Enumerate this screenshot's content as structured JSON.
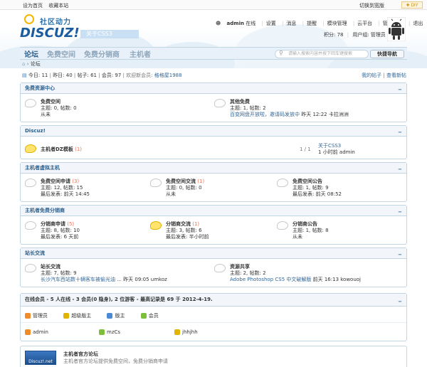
{
  "topbar": {
    "set_home": "设为首页",
    "bookmark": "收藏本站",
    "switch_width": "切换到宽版",
    "diy": "DIY"
  },
  "header": {
    "logo_cn": "社区动力",
    "logo_en": "DISCUZ!",
    "about": "关于CSS3",
    "user": {
      "name": "admin",
      "status": "在线",
      "links": [
        "设置",
        "消息",
        "提醒",
        "模块管理",
        "云平台",
        "管理中心",
        "退出"
      ],
      "points_label": "积分: 78",
      "group_label": "用户组: 管理员"
    }
  },
  "nav": {
    "items": [
      "论坛",
      "免费空间",
      "免费分销商",
      "主机者"
    ],
    "search_placeholder": "请输入搜索内容并按下回车键搜索",
    "quick_nav": "快捷导航"
  },
  "breadcrumb": {
    "label": "论坛"
  },
  "stats": {
    "today": "今日: 11",
    "yesterday": "昨日: 40",
    "posts": "帖子: 61",
    "members": "会员: 97",
    "welcome_prefix": "欢迎新会员: ",
    "new_member": "格格屋1988",
    "my_posts": "我的帖子",
    "new_posts": "查看新帖"
  },
  "categories": [
    {
      "title": "免费资源中心",
      "forums": [
        {
          "name": "免费空间",
          "count": "",
          "line2": "主题: 0, 帖数: 0",
          "line3": "从未",
          "line3_link": "",
          "line3_time": ""
        },
        {
          "name": "其他免费",
          "count": "",
          "line2": "主题: 1, 帖数: 2",
          "line3": "",
          "line3_link": "百变网盘开放啦，邀请码发放中",
          "line3_time": "昨天 12:22  卡拉洲洲"
        }
      ]
    },
    {
      "title": "Discuz!",
      "forums": [
        {
          "name": "主机者DZ模板",
          "count": "(1)",
          "pages": "1 / 1",
          "last_link": "关于CSS3",
          "last_time": "1 小时前  admin"
        }
      ]
    },
    {
      "title": "主机者虚拟主机",
      "forums": [
        {
          "name": "免费空间申请",
          "count": "(3)",
          "line2": "主题: 12, 帖数: 15",
          "line3": "最后发表: 前天 14:45"
        },
        {
          "name": "免费空间交流",
          "count": "(1)",
          "line2": "主题: 0, 帖数: 0",
          "line3": "从未"
        },
        {
          "name": "免费空间公告",
          "count": "",
          "line2": "主题: 1, 帖数: 9",
          "line3": "最后发表: 前天 08:52"
        }
      ]
    },
    {
      "title": "主机者免费分销商",
      "forums": [
        {
          "name": "分销商申请",
          "count": "(5)",
          "line2": "主题: 8, 帖数: 10",
          "line3": "最后发表: 6 天前"
        },
        {
          "name": "分销商交流",
          "count": "(1)",
          "line2": "主题: 3, 帖数: 6",
          "line3": "最后发表: 半小时前"
        },
        {
          "name": "分销商公告",
          "count": "",
          "line2": "主题: 1, 帖数: 8",
          "line3": "从未"
        }
      ]
    },
    {
      "title": "站长交流",
      "forums": [
        {
          "name": "站长交流",
          "count": "",
          "line2": "主题: 7, 帖数: 9",
          "line3_link": "长沙汽车西站数十辆客车被偷光油 ...",
          "line3_time": "昨天 09:05  umkoz"
        },
        {
          "name": "资源共享",
          "count": "",
          "line2": "主题: 2, 帖数: 2",
          "line3_link": "Adobe Photoshop CS5 中文破解版",
          "line3_time": "前天 16:13  kowouoj"
        }
      ]
    }
  ],
  "online": {
    "title": "在线会员 - 5 人在线 - 3 会员(0 隐身), 2 位游客 - 最高记录是 69 于 2012-4-19.",
    "legend": [
      "管理员",
      "超级版主",
      "版主",
      "会员"
    ],
    "users": [
      "admin",
      "mzCs",
      "jhhjhh"
    ],
    "colors": {
      "admin": "#f08c2a",
      "super": "#e0b400",
      "mod": "#4a8ad4",
      "member": "#7dbf3a"
    }
  },
  "links_box": {
    "title": "主机者官方论坛",
    "desc": "主机者官方论坛提供免费空间，免费分销商申请",
    "logo_text": "Discuz!.net"
  }
}
